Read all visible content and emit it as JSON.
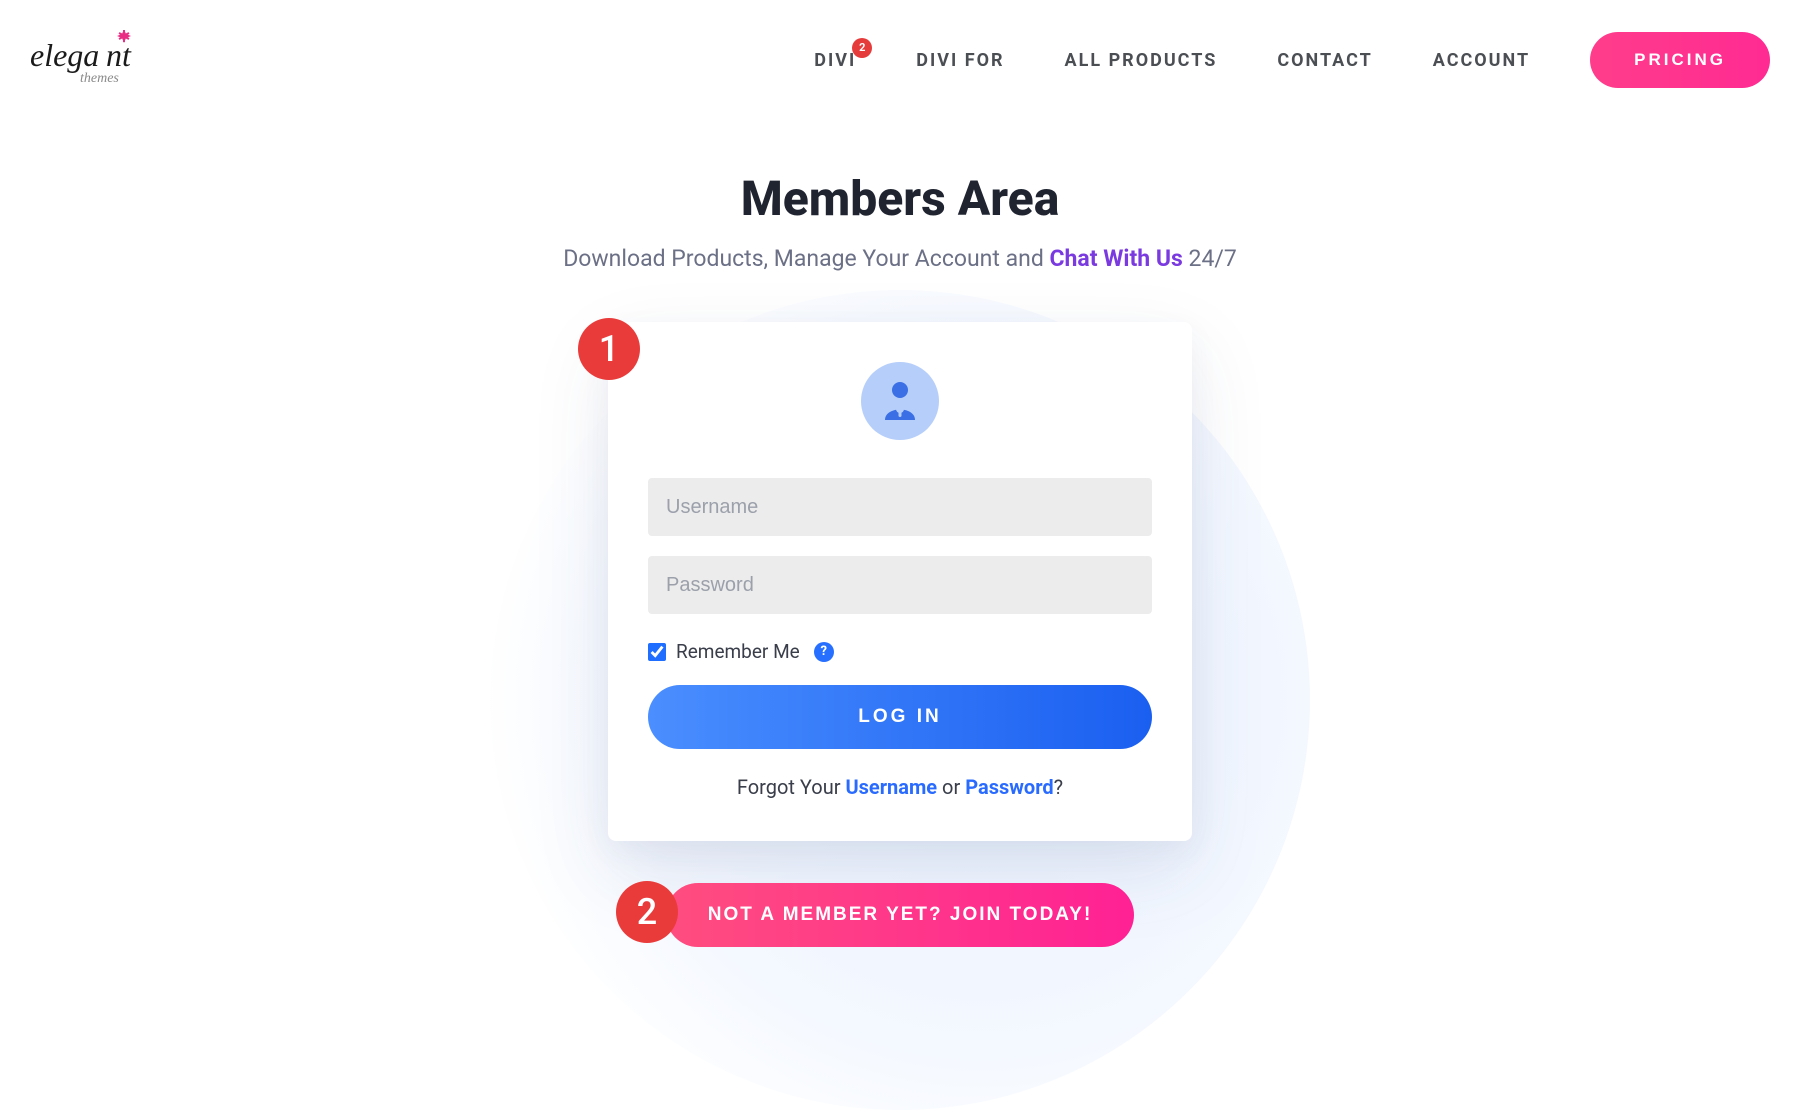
{
  "brand": {
    "name": "elegant",
    "subname": "themes"
  },
  "nav": {
    "items": [
      "DIVI",
      "DIVI FOR",
      "ALL PRODUCTS",
      "CONTACT",
      "ACCOUNT"
    ],
    "divi_badge": "2",
    "pricing_label": "PRICING"
  },
  "page": {
    "title": "Members Area",
    "subtitle_prefix": "Download Products, Manage Your Account and ",
    "subtitle_link": "Chat With Us",
    "subtitle_suffix": " 24/7"
  },
  "login": {
    "step1_badge": "1",
    "username_placeholder": "Username",
    "password_placeholder": "Password",
    "remember_label": "Remember Me",
    "help_icon": "?",
    "login_button": "LOG IN",
    "forgot_prefix": "Forgot Your ",
    "forgot_username": "Username",
    "forgot_or": " or ",
    "forgot_password": "Password",
    "forgot_suffix": "?"
  },
  "join": {
    "step2_badge": "2",
    "button_label": "NOT A MEMBER YET? JOIN TODAY!"
  }
}
